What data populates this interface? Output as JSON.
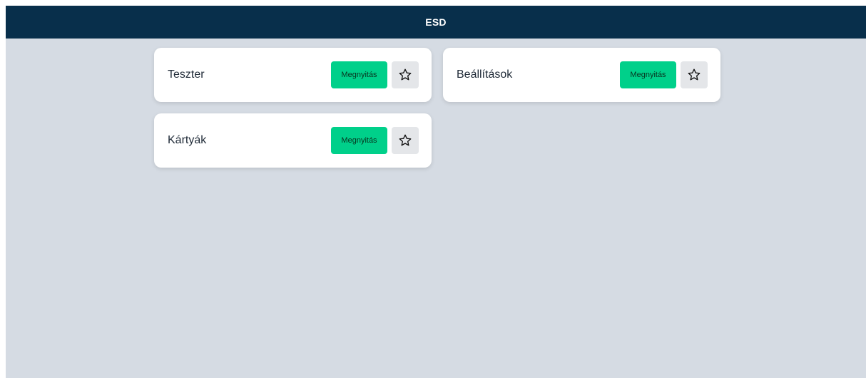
{
  "header": {
    "title": "ESD"
  },
  "cards": [
    {
      "title": "Teszter",
      "open_label": "Megnyitás",
      "favorite_icon": "star-outline-icon"
    },
    {
      "title": "Beállítások",
      "open_label": "Megnyitás",
      "favorite_icon": "star-outline-icon"
    },
    {
      "title": "Kártyák",
      "open_label": "Megnyitás",
      "favorite_icon": "star-outline-icon"
    }
  ],
  "colors": {
    "header_bg": "#082f4b",
    "page_bg": "#d5dbe3",
    "accent": "#00d08a",
    "favorite_btn_bg": "#e4e6e9"
  }
}
